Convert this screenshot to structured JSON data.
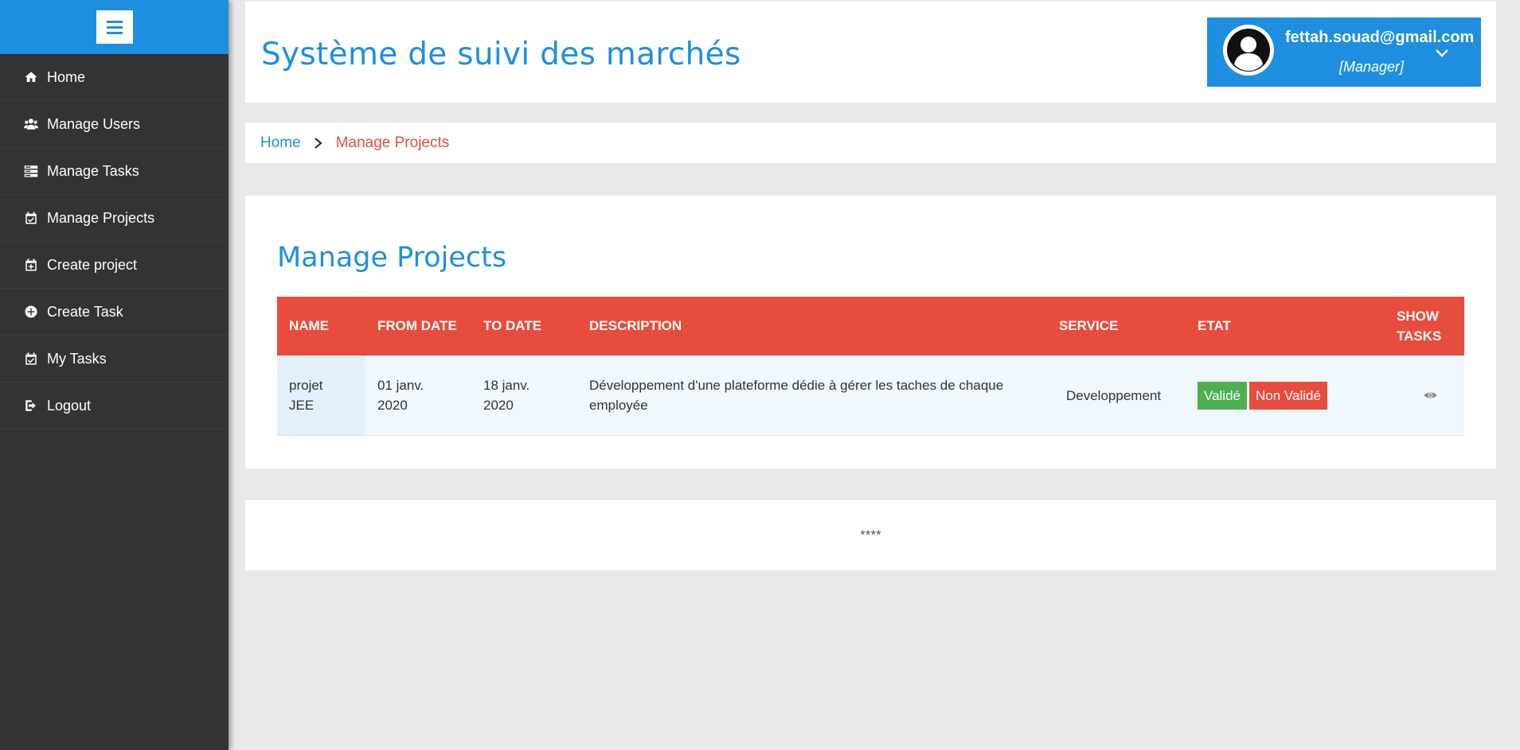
{
  "sidebar": {
    "items": [
      {
        "label": "Home",
        "icon": "home-icon"
      },
      {
        "label": "Manage Users",
        "icon": "users-icon"
      },
      {
        "label": "Manage Tasks",
        "icon": "tasks-icon"
      },
      {
        "label": "Manage Projects",
        "icon": "calendar-check-icon"
      },
      {
        "label": "Create project",
        "icon": "calendar-plus-icon"
      },
      {
        "label": "Create Task",
        "icon": "plus-circle-icon"
      },
      {
        "label": "My Tasks",
        "icon": "calendar-check-icon"
      },
      {
        "label": "Logout",
        "icon": "logout-icon"
      }
    ]
  },
  "header": {
    "title": "Système de suivi des marchés",
    "user_email": "fettah.souad@gmail.com",
    "user_role": "[Manager]"
  },
  "breadcrumb": {
    "home": "Home",
    "current": "Manage Projects"
  },
  "main": {
    "title": "Manage Projects",
    "columns": [
      "NAME",
      "FROM DATE",
      "TO DATE",
      "DESCRIPTION",
      "SERVICE",
      "ETAT",
      "SHOW TASKS"
    ],
    "rows": [
      {
        "name": "projet JEE",
        "from_date": "01 janv. 2020",
        "to_date": "18 janv. 2020",
        "description": "Développement d'une plateforme dédie à gérer les taches de chaque employée",
        "service": "Developpement",
        "etat_valid": "Validé",
        "etat_invalid": "Non Validé"
      }
    ]
  },
  "footer": {
    "text": "****"
  },
  "colors": {
    "primary": "#1e8fe0",
    "accent": "#e84c3d",
    "success": "#4caf50",
    "sidebar": "#333333"
  }
}
